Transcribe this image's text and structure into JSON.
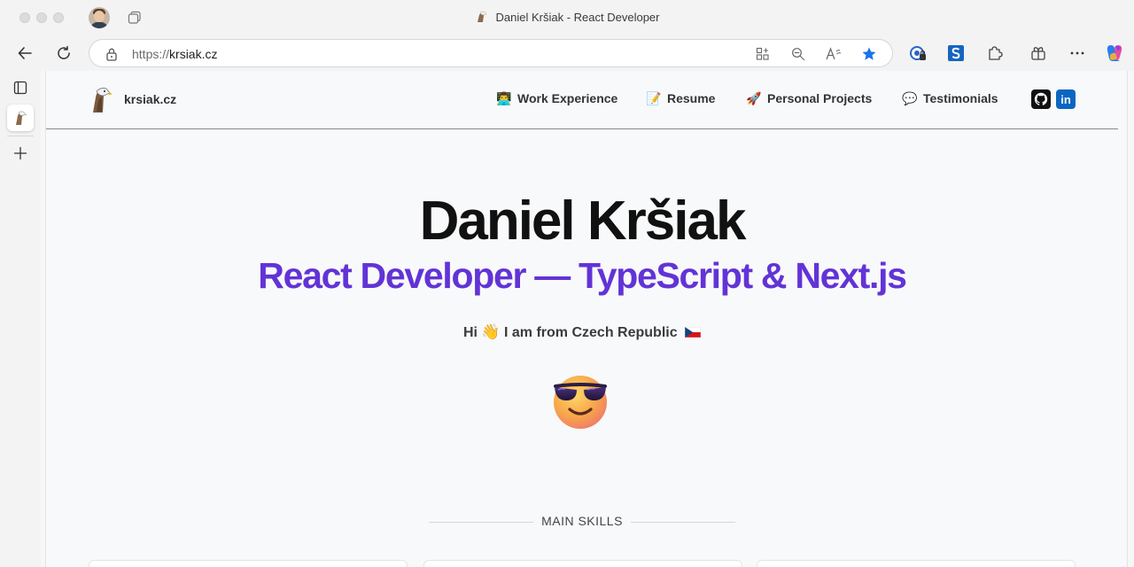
{
  "browser": {
    "window_title": "Daniel Kršiak - React Developer",
    "url_protocol": "https://",
    "url_host": "krsiak.cz"
  },
  "site": {
    "brand": "krsiak.cz",
    "nav": [
      {
        "emoji": "👨‍💻",
        "label": "Work Experience"
      },
      {
        "emoji": "📝",
        "label": "Resume"
      },
      {
        "emoji": "🚀",
        "label": "Personal Projects"
      },
      {
        "emoji": "💬",
        "label": "Testimonials"
      }
    ],
    "social": {
      "linkedin_label": "in"
    }
  },
  "hero": {
    "name": "Daniel Kršiak",
    "subtitle": "React Developer  —  TypeScript & Next.js",
    "greeting_prefix": "Hi",
    "greeting_emoji": "👋",
    "greeting_text": "I am from Czech Republic"
  },
  "section": {
    "skills_label": "MAIN SKILLS"
  },
  "colors": {
    "accent": "#6233d6",
    "heading": "#111111",
    "linkedin": "#0a66c2",
    "github": "#111111",
    "bookmark_star": "#1a73e8"
  }
}
